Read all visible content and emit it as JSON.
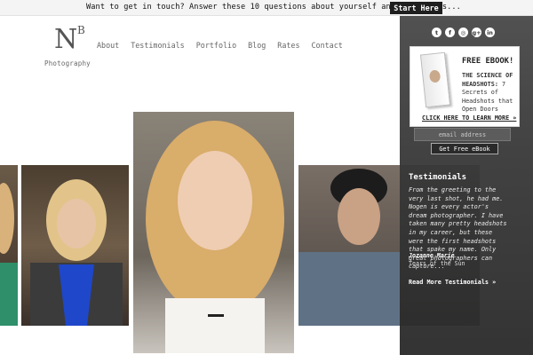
{
  "topbar": {
    "text": "Want to get in touch? Answer these 10 questions about yourself and your goals...",
    "button": "Start Here"
  },
  "logo": {
    "letter_main": "N",
    "letter_sup": "B",
    "sub": "Photography"
  },
  "nav": {
    "items": [
      "About",
      "Testimonials",
      "Portfolio",
      "Blog",
      "Rates",
      "Contact"
    ]
  },
  "social": {
    "icons": [
      "twitter-icon",
      "facebook-icon",
      "instagram-icon",
      "google-plus-icon",
      "linkedin-icon"
    ],
    "glyphs": [
      "t",
      "f",
      "◎",
      "g+",
      "in"
    ]
  },
  "ebook": {
    "title": "FREE EBOOK!",
    "desc_bold": "THE SCIENCE OF HEADSHOTS:",
    "desc_rest": " 7 Secrets of Headshots that Open Doors",
    "link": "CLICK HERE TO LEARN MORE »",
    "email_placeholder": "email address",
    "button": "Get Free eBook"
  },
  "testimonial": {
    "heading": "Testimonials",
    "quote": "From the greeting to the very last shot, he had me. Nogen is every actor's dream photographer. I have taken many pretty headshots in my career, but these were the first headshots that spake my name. Only great photographers can capture...",
    "name": "Jozanne Marie",
    "credit": "Tears of the Sun",
    "more": "Read More Testimonials »"
  },
  "colors": {
    "sidebar": "#3a3a3a",
    "topbar_button": "#1f1f1f"
  }
}
